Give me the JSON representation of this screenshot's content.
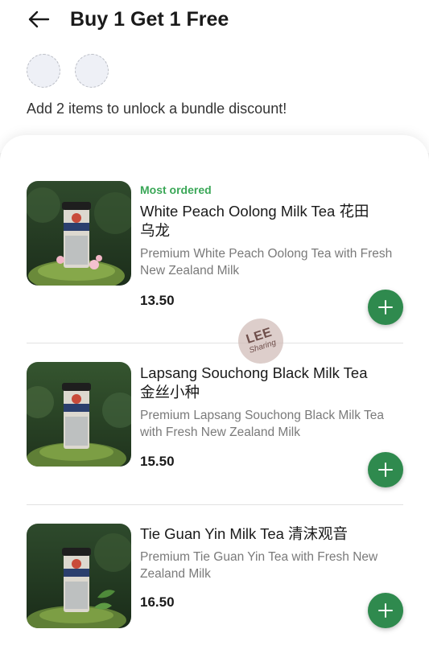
{
  "header": {
    "title": "Buy 1 Get 1 Free",
    "back_icon": "arrow-left-icon",
    "hint": "Add 2 items to unlock a bundle discount!"
  },
  "bundle_slots": [
    {
      "state": "empty"
    },
    {
      "state": "empty"
    }
  ],
  "items": [
    {
      "badge": "Most ordered",
      "name": "White Peach Oolong Milk Tea 花田乌龙",
      "description": "Premium White Peach Oolong Tea with Fresh New Zealand Milk",
      "price": "13.50",
      "add_icon": "plus-icon",
      "image": "cup-photo-with-pink-flowers"
    },
    {
      "name": "Lapsang Souchong Black Milk Tea 金丝小种",
      "description": "Premium Lapsang Souchong Black Milk Tea with Fresh New Zealand Milk",
      "price": "15.50",
      "add_icon": "plus-icon",
      "image": "cup-photo-on-moss"
    },
    {
      "name": "Tie Guan Yin Milk Tea 清沫观音",
      "description": "Premium Tie Guan Yin Tea with Fresh New Zealand Milk",
      "price": "16.50",
      "add_icon": "plus-icon",
      "image": "cup-photo-with-leaves"
    }
  ],
  "watermark": {
    "line1": "LEE",
    "line2": "Sharing"
  },
  "colors": {
    "accent_green": "#2f8a4e",
    "badge_green": "#3aa757",
    "background": "#f2f2f2"
  }
}
